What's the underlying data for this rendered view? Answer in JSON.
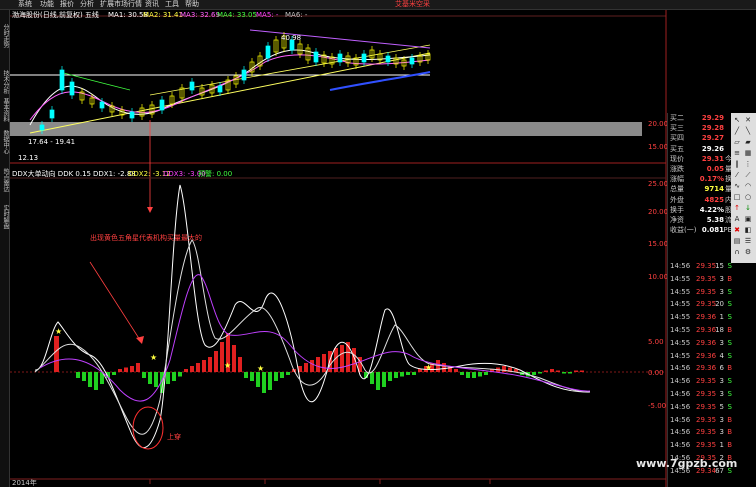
{
  "menu": [
    "系统",
    "功能",
    "报价",
    "分析",
    "扩展市场行情",
    "资讯",
    "工具",
    "帮助"
  ],
  "menu_notice": "艾基米空采",
  "sidebar_tabs": [
    "分时走势",
    "技术分析",
    "基本资料",
    "数据中心",
    "热点雷达",
    "实时解盘"
  ],
  "main_chart": {
    "header_name": "渤海股份(日线,前复权) 五线",
    "ma1_label": "MA1: 30.58",
    "ma2_label": "MA2: 31.41",
    "ma3_label": "MA3: 32.69",
    "ma4_label": "MA4: 33.05",
    "ma5_label": "MA5: -",
    "ma6_label": "MA6: -",
    "peak_label": "40.98",
    "low_label1": "17.64 - 19.41",
    "low_label2": "12.13",
    "right_scale": [
      "20.00",
      "15.00"
    ],
    "colors": {
      "bull": "#ffff00",
      "bear": "#00ffff",
      "ma1": "#ffffff",
      "ma2": "#ffff40",
      "ma3": "#ff40ff",
      "ma4": "#40ff40",
      "ma_blue": "#3050ff"
    }
  },
  "ddx_chart": {
    "header_name": "DDX大单动向 DDK 0.15",
    "ddx1": "DDX1: -2.88",
    "ddx2": "DDX2: -3.12",
    "ddx3": "DDX3: -3.00",
    "warn": "预警: 0.00",
    "annotation": "出现黄色五角星代表机构买量最大的",
    "circle_label": "上穿",
    "y_ticks": [
      "25.00",
      "20.00",
      "15.00",
      "10.00",
      "5.00",
      "0.00",
      "-5.00"
    ],
    "bottom_date": "2014年"
  },
  "quote": {
    "rows": [
      {
        "label": "买二",
        "value": "29.29",
        "color": "#ff4040",
        "suffix": ""
      },
      {
        "label": "买三",
        "value": "29.28",
        "color": "#ff4040",
        "suffix": ""
      },
      {
        "label": "买四",
        "value": "29.27",
        "color": "#ff4040",
        "suffix": ""
      },
      {
        "label": "买五",
        "value": "29.26",
        "color": "#ffffff",
        "suffix": ""
      },
      {
        "label": "现价",
        "value": "29.31",
        "color": "#ff4040",
        "suffix": "今"
      },
      {
        "label": "涨跌",
        "value": "0.05",
        "color": "#ff4040",
        "suffix": "量"
      },
      {
        "label": "涨幅",
        "value": "0.17%",
        "color": "#ff4040",
        "suffix": "换"
      },
      {
        "label": "总量",
        "value": "9714",
        "color": "#ffff40",
        "suffix": "量"
      },
      {
        "label": "外盘",
        "value": "4825",
        "color": "#ff4040",
        "suffix": "内"
      },
      {
        "label": "换手",
        "value": "4.22%",
        "color": "#ffffff",
        "suffix": "股"
      },
      {
        "label": "净资",
        "value": "5.38",
        "color": "#ffffff",
        "suffix": "流"
      },
      {
        "label": "收益(一)",
        "value": "0.081",
        "color": "#ffffff",
        "suffix": "PE"
      }
    ],
    "ticks": [
      {
        "time": "14:56",
        "price": "29.35",
        "vol": "15",
        "side": "S"
      },
      {
        "time": "14:55",
        "price": "29.35",
        "vol": "3",
        "side": "B"
      },
      {
        "time": "14:55",
        "price": "29.35",
        "vol": "3",
        "side": "S"
      },
      {
        "time": "14:55",
        "price": "29.35",
        "vol": "20",
        "side": "S"
      },
      {
        "time": "14:55",
        "price": "29.36",
        "vol": "1",
        "side": "S"
      },
      {
        "time": "14:55",
        "price": "29.36",
        "vol": "18",
        "side": "B"
      },
      {
        "time": "14:55",
        "price": "29.36",
        "vol": "3",
        "side": "S"
      },
      {
        "time": "14:55",
        "price": "29.36",
        "vol": "4",
        "side": "S"
      },
      {
        "time": "14:56",
        "price": "29.36",
        "vol": "6",
        "side": "B"
      },
      {
        "time": "14:56",
        "price": "29.35",
        "vol": "3",
        "side": "S"
      },
      {
        "time": "14:56",
        "price": "29.35",
        "vol": "3",
        "side": "S"
      },
      {
        "time": "14:56",
        "price": "29.35",
        "vol": "5",
        "side": "S"
      },
      {
        "time": "14:56",
        "price": "29.35",
        "vol": "3",
        "side": "B"
      },
      {
        "time": "14:56",
        "price": "29.35",
        "vol": "3",
        "side": "B"
      },
      {
        "time": "14:56",
        "price": "29.35",
        "vol": "1",
        "side": "B"
      },
      {
        "time": "14:56",
        "price": "29.35",
        "vol": "2",
        "side": "B"
      },
      {
        "time": "14:56",
        "price": "29.34",
        "vol": "67",
        "side": "S"
      }
    ]
  },
  "watermark": "www.7gpzb.com"
}
